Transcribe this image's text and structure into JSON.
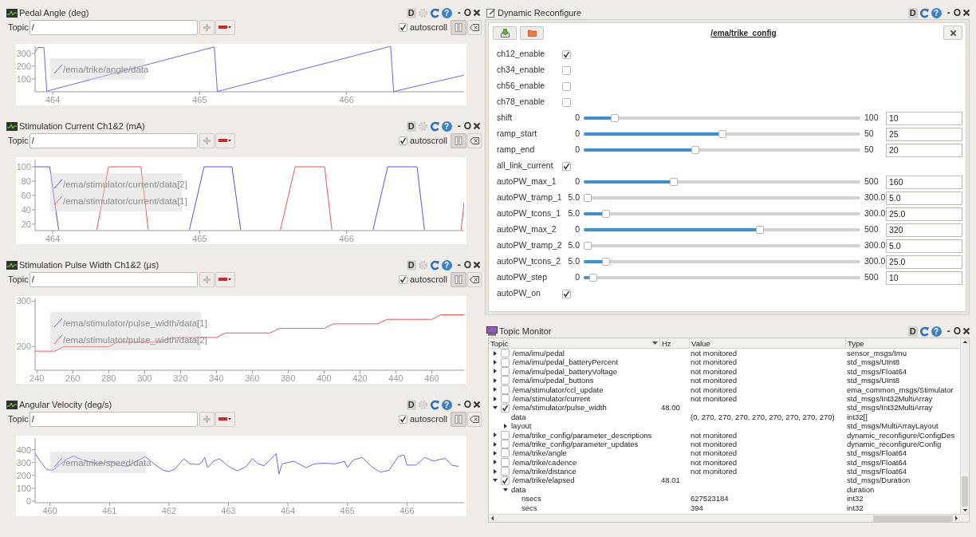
{
  "plots": [
    {
      "title": "Pedal Angle (deg)",
      "controls": [
        {
          "kind": "dock",
          "label": "D"
        },
        {
          "kind": "gear"
        },
        {
          "kind": "reload"
        },
        {
          "kind": "help",
          "label": "?"
        },
        {
          "kind": "minimize",
          "label": "-"
        },
        {
          "kind": "float",
          "label": "O"
        },
        {
          "kind": "close"
        }
      ],
      "topic_label": "Topic",
      "topic_value": "/",
      "autoscroll": {
        "label": "autoscroll",
        "checked": true
      },
      "chart_data": {
        "type": "line",
        "legend": "center left",
        "x": [
          463.88,
          463.9,
          463.94,
          463.96,
          465.1,
          465.12,
          466.3,
          466.32,
          466.8
        ],
        "xlim": [
          463.88,
          466.8
        ],
        "ylim": [
          0,
          355
        ],
        "xticks": [
          464,
          465,
          466
        ],
        "yticks": [
          100,
          200,
          300
        ],
        "series": [
          {
            "name": "/ema/trike/angle/data",
            "color": "#6666ff",
            "values": [
              310,
              345,
              345,
              5,
              350,
              2,
              355,
              2,
              130
            ]
          }
        ]
      }
    },
    {
      "title": "Stimulation Current Ch1&2 (mA)",
      "controls": [
        {
          "kind": "dock",
          "label": "D"
        },
        {
          "kind": "gear"
        },
        {
          "kind": "reload"
        },
        {
          "kind": "help",
          "label": "?"
        },
        {
          "kind": "minimize",
          "label": "-"
        },
        {
          "kind": "float",
          "label": "O"
        },
        {
          "kind": "close"
        }
      ],
      "topic_label": "Topic",
      "topic_value": "/",
      "autoscroll": {
        "label": "autoscroll",
        "checked": true
      },
      "chart_data": {
        "type": "line",
        "legend": "upper left",
        "x": [
          463.88,
          463.98,
          464.04,
          464.3,
          464.38,
          464.6,
          464.65,
          464.93,
          465.03,
          465.22,
          465.28,
          465.55,
          465.65,
          465.85,
          465.9,
          466.18,
          466.28,
          466.48,
          466.53,
          466.78,
          466.8
        ],
        "xlim": [
          463.88,
          466.8
        ],
        "ylim": [
          11,
          110
        ],
        "xticks": [
          464,
          465,
          466
        ],
        "yticks": [
          20,
          40,
          60,
          80,
          100
        ],
        "series": [
          {
            "name": "/ema/stimulator/current/data[2]",
            "color": "#5050ff",
            "values": [
              100,
              100,
              12,
              null,
              null,
              null,
              null,
              12,
              100,
              100,
              12,
              null,
              null,
              null,
              null,
              12,
              100,
              100,
              12,
              null,
              null
            ]
          },
          {
            "name": "/ema/stimulator/current/data[1]",
            "color": "#ff5050",
            "values": [
              null,
              null,
              null,
              12,
              100,
              100,
              12,
              null,
              null,
              null,
              null,
              12,
              100,
              100,
              12,
              null,
              null,
              null,
              null,
              12,
              50
            ]
          }
        ]
      }
    },
    {
      "title": "Stimulation Pulse Width Ch1&2 (μs)",
      "controls": [
        {
          "kind": "dock",
          "label": "D"
        },
        {
          "kind": "gear"
        },
        {
          "kind": "reload"
        },
        {
          "kind": "help",
          "label": "?"
        },
        {
          "kind": "minimize",
          "label": "-"
        },
        {
          "kind": "float",
          "label": "O"
        },
        {
          "kind": "close"
        }
      ],
      "topic_label": "Topic",
      "topic_value": "/",
      "autoscroll": {
        "label": "autoscroll",
        "checked": true
      },
      "chart_data": {
        "type": "line",
        "legend": "upper left",
        "x": [
          239,
          250,
          255,
          280,
          285,
          310,
          315,
          340,
          345,
          370,
          375,
          400,
          405,
          430,
          435,
          460,
          465,
          478
        ],
        "xlim": [
          239,
          478
        ],
        "ylim": [
          148,
          306
        ],
        "xticks": [
          240,
          260,
          280,
          300,
          320,
          340,
          360,
          380,
          400,
          420,
          440,
          460
        ],
        "yticks": [
          200,
          300
        ],
        "series": [
          {
            "name": "/ema/stimulator/pulse_width/data[1]",
            "color": "#6666ff",
            "values": [
              null,
              null,
              null,
              null,
              null,
              null,
              null,
              null,
              null,
              null,
              null,
              null,
              null,
              null,
              null,
              null,
              null,
              null
            ]
          },
          {
            "name": "/ema/stimulator/pulse_width/data[2]",
            "color": "#ff5050",
            "values": [
              190,
              190,
              200,
              200,
              210,
              210,
              220,
              220,
              230,
              230,
              240,
              240,
              250,
              250,
              260,
              260,
              270,
              270
            ]
          }
        ]
      }
    },
    {
      "title": "Angular Velocity (deg/s)",
      "controls": [
        {
          "kind": "dock",
          "label": "D"
        },
        {
          "kind": "gear"
        },
        {
          "kind": "reload"
        },
        {
          "kind": "help",
          "label": "?"
        },
        {
          "kind": "minimize",
          "label": "-"
        },
        {
          "kind": "float",
          "label": "O"
        },
        {
          "kind": "close"
        }
      ],
      "topic_label": "Topic",
      "topic_value": "/",
      "autoscroll": {
        "label": "autoscroll",
        "checked": true
      },
      "chart_data": {
        "type": "line",
        "legend": "upper left",
        "x": [
          459.75,
          459.85,
          459.95,
          460.05,
          460.15,
          460.3,
          460.4,
          460.55,
          460.7,
          460.85,
          461.0,
          461.15,
          461.3,
          461.45,
          461.6,
          461.75,
          461.9,
          462.0,
          462.1,
          462.25,
          462.35,
          462.5,
          462.55,
          462.6,
          462.65,
          462.75,
          462.85,
          463.0,
          463.15,
          463.3,
          463.4,
          463.5,
          463.6,
          463.8,
          463.85,
          463.9,
          464.1,
          464.3,
          464.45,
          464.6,
          464.8,
          464.95,
          465.0,
          465.1,
          465.25,
          465.4,
          465.55,
          465.7,
          465.85,
          465.95,
          466.0,
          466.15,
          466.3,
          466.45,
          466.55,
          466.65,
          466.75,
          466.87
        ],
        "xlim": [
          459.75,
          466.96
        ],
        "ylim": [
          -12,
          490
        ],
        "xticks": [
          460,
          461,
          462,
          463,
          464,
          465,
          466
        ],
        "yticks": [
          0,
          100,
          200,
          300,
          400
        ],
        "series": [
          {
            "name": "/ema/trike/speed/data",
            "color": "#6666ff",
            "values": [
              370,
              300,
              245,
              240,
              280,
              330,
              350,
              320,
              300,
              290,
              310,
              280,
              270,
              310,
              345,
              290,
              240,
              230,
              250,
              330,
              290,
              285,
              300,
              340,
              260,
              310,
              330,
              270,
              235,
              270,
              330,
              290,
              275,
              370,
              210,
              290,
              310,
              260,
              290,
              295,
              290,
              310,
              260,
              320,
              340,
              270,
              225,
              240,
              345,
              360,
              280,
              280,
              340,
              310,
              325,
              330,
              280,
              270
            ]
          }
        ]
      }
    }
  ],
  "reconfigure": {
    "title": "Dynamic Reconfigure",
    "controls": [
      {
        "kind": "dock",
        "label": "D"
      },
      {
        "kind": "reload"
      },
      {
        "kind": "help",
        "label": "?"
      },
      {
        "kind": "minimize",
        "label": "-"
      },
      {
        "kind": "float",
        "label": "O"
      },
      {
        "kind": "close"
      }
    ],
    "config_name": "/ema/trike_config",
    "params": [
      {
        "kind": "checkbox",
        "name": "ch12_enable",
        "checked": true
      },
      {
        "kind": "checkbox",
        "name": "ch34_enable",
        "checked": false
      },
      {
        "kind": "checkbox",
        "name": "ch56_enable",
        "checked": false
      },
      {
        "kind": "checkbox",
        "name": "ch78_enable",
        "checked": false
      },
      {
        "kind": "slider",
        "name": "shift",
        "min": "0",
        "max": "100",
        "value": "10",
        "level": 0.1
      },
      {
        "kind": "slider",
        "name": "ramp_start",
        "min": "0",
        "max": "50",
        "value": "25",
        "level": 0.5
      },
      {
        "kind": "slider",
        "name": "ramp_end",
        "min": "0",
        "max": "50",
        "value": "20",
        "level": 0.4
      },
      {
        "kind": "checkbox",
        "name": "all_link_current",
        "checked": true
      },
      {
        "kind": "slider",
        "name": "autoPW_max_1",
        "min": "0",
        "max": "500",
        "value": "160",
        "level": 0.32
      },
      {
        "kind": "slider",
        "name": "autoPW_tramp_1",
        "min": "5.0",
        "max": "300.0",
        "value": "5.0",
        "level": 0
      },
      {
        "kind": "slider",
        "name": "autoPW_tcons_1",
        "min": "5.0",
        "max": "300.0",
        "value": "25.0",
        "level": 0.068
      },
      {
        "kind": "slider",
        "name": "autoPW_max_2",
        "min": "0",
        "max": "500",
        "value": "320",
        "level": 0.64
      },
      {
        "kind": "slider",
        "name": "autoPW_tramp_2",
        "min": "5.0",
        "max": "300.0",
        "value": "5.0",
        "level": 0
      },
      {
        "kind": "slider",
        "name": "autoPW_tcons_2",
        "min": "5.0",
        "max": "300.0",
        "value": "25.0",
        "level": 0.068
      },
      {
        "kind": "slider",
        "name": "autoPW_step",
        "min": "0",
        "max": "500",
        "value": "10",
        "level": 0.02
      },
      {
        "kind": "checkbox",
        "name": "autoPW_on",
        "checked": true
      }
    ]
  },
  "topic_monitor": {
    "title": "Topic Monitor",
    "controls": [
      {
        "kind": "dock",
        "label": "D"
      },
      {
        "kind": "reload"
      },
      {
        "kind": "help",
        "label": "?"
      },
      {
        "kind": "minimize",
        "label": "-"
      },
      {
        "kind": "float",
        "label": "O"
      },
      {
        "kind": "close"
      }
    ],
    "columns": [
      "Topic",
      "Hz",
      "Value",
      "Type"
    ],
    "rows": [
      {
        "topic": "/ema/imu/pedal",
        "expanded": false,
        "checked": false,
        "value": "not monitored",
        "type": "sensor_msgs/Imu"
      },
      {
        "topic": "/ema/imu/pedal_batteryPercent",
        "expanded": false,
        "checked": false,
        "value": "not monitored",
        "type": "std_msgs/UInt8"
      },
      {
        "topic": "/ema/imu/pedal_batteryVoltage",
        "expanded": false,
        "checked": false,
        "value": "not monitored",
        "type": "std_msgs/Float64"
      },
      {
        "topic": "/ema/imu/pedal_buttons",
        "expanded": false,
        "checked": false,
        "value": "not monitored",
        "type": "std_msgs/UInt8"
      },
      {
        "topic": "/ema/stimulator/ccl_update",
        "expanded": false,
        "checked": false,
        "value": "not monitored",
        "type": "ema_common_msgs/Stimulator"
      },
      {
        "topic": "/ema/stimulator/current",
        "expanded": false,
        "checked": false,
        "value": "not monitored",
        "type": "std_msgs/Int32MultiArray"
      },
      {
        "topic": "/ema/stimulator/pulse_width",
        "expanded": true,
        "checked": true,
        "hz": "48.00",
        "type": "std_msgs/Int32MultiArray",
        "children": [
          {
            "topic": "data",
            "value": "(0, 270, 270, 270, 270, 270, 270, 270, 270)",
            "type": "int32[]"
          },
          {
            "topic": "layout",
            "expanded": false,
            "type": "std_msgs/MultiArrayLayout"
          }
        ]
      },
      {
        "topic": "/ema/trike_config/parameter_descriptions",
        "expanded": false,
        "checked": false,
        "value": "not monitored",
        "type": "dynamic_reconfigure/ConfigDes"
      },
      {
        "topic": "/ema/trike_config/parameter_updates",
        "expanded": false,
        "checked": false,
        "value": "not monitored",
        "type": "dynamic_reconfigure/Config"
      },
      {
        "topic": "/ema/trike/angle",
        "expanded": false,
        "checked": false,
        "value": "not monitored",
        "type": "std_msgs/Float64"
      },
      {
        "topic": "/ema/trike/cadence",
        "expanded": false,
        "checked": false,
        "value": "not monitored",
        "type": "std_msgs/Float64"
      },
      {
        "topic": "/ema/trike/distance",
        "expanded": false,
        "checked": false,
        "value": "not monitored",
        "type": "std_msgs/Float64"
      },
      {
        "topic": "/ema/trike/elapsed",
        "expanded": true,
        "checked": true,
        "hz": "48.01",
        "type": "std_msgs/Duration",
        "children": [
          {
            "topic": "data",
            "expanded": true,
            "type": "duration",
            "children": [
              {
                "topic": "nsecs",
                "value": "627523184",
                "type": "int32"
              },
              {
                "topic": "secs",
                "value": "394",
                "type": "int32"
              }
            ]
          }
        ]
      }
    ]
  }
}
